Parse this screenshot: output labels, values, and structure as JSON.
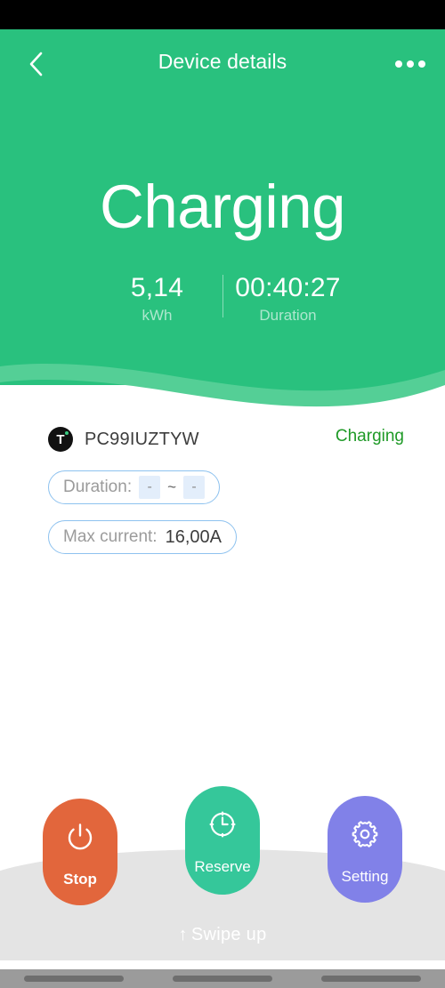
{
  "header": {
    "back_icon": "chevron-left-icon",
    "title": "Device details",
    "more_icon": "more-options-icon",
    "bg_color": "#29c17e"
  },
  "hero": {
    "title": "Charging",
    "stats": [
      {
        "value": "5,14",
        "unit": "kWh"
      },
      {
        "value": "00:40:27",
        "unit": "Duration"
      }
    ]
  },
  "device": {
    "badge_glyph": "T",
    "name": "PC99IUZTYW",
    "status": "Charging",
    "status_color": "#1f9a27"
  },
  "settings_chips": {
    "duration": {
      "label": "Duration:",
      "start": "-",
      "separator": "~",
      "end": "-"
    },
    "max_current": {
      "label": "Max current:",
      "value": "16,00A"
    }
  },
  "actions": [
    {
      "label": "Stop",
      "icon": "power-icon",
      "color": "#e2663c"
    },
    {
      "label": "Reserve",
      "icon": "clock-icon",
      "color": "#35c79a"
    },
    {
      "label": "Setting",
      "icon": "gear-icon",
      "color": "#8181e8"
    }
  ],
  "bottom_sheet": {
    "swipe_arrow": "↑",
    "swipe_label": "Swipe up"
  }
}
